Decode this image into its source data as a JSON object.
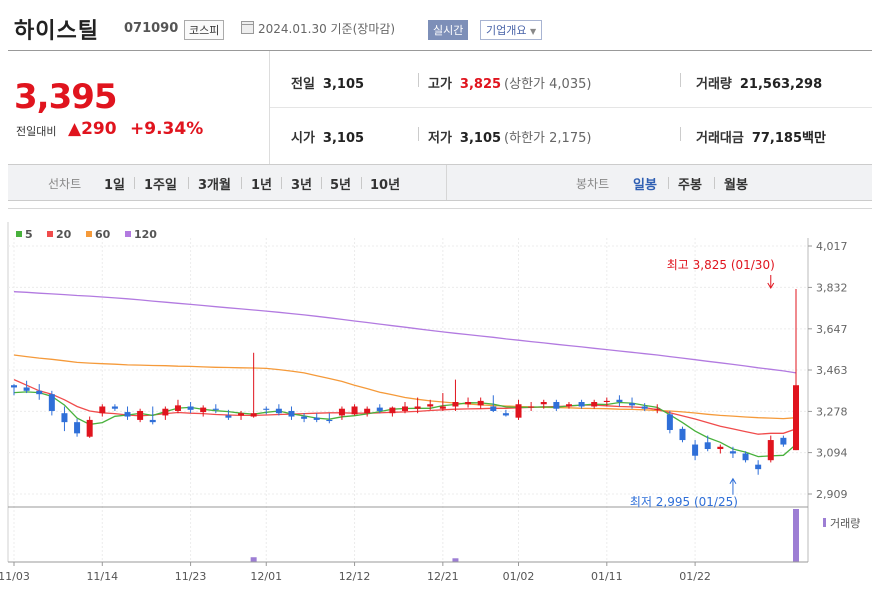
{
  "header": {
    "name": "하이스틸",
    "code": "071090",
    "market": "코스피",
    "date": "2024.01.30 기준(장마감)",
    "realtime_label": "실시간",
    "company_info_label": "기업개요"
  },
  "price": {
    "current": "3,395",
    "change_label": "전일대비",
    "change_value": "290",
    "change_pct": "+9.34%"
  },
  "summary": {
    "prev_close": {
      "label": "전일",
      "value": "3,105"
    },
    "high": {
      "label": "고가",
      "value": "3,825",
      "limit_label": "(상한가",
      "limit_value": "4,035)"
    },
    "volume": {
      "label": "거래량",
      "value": "21,563,298"
    },
    "open": {
      "label": "시가",
      "value": "3,105"
    },
    "low": {
      "label": "저가",
      "value": "3,105",
      "limit_label": "(하한가",
      "limit_value": "2,175)"
    },
    "amount": {
      "label": "거래대금",
      "value": "77,185",
      "unit": "백만"
    }
  },
  "toolbar": {
    "line_label": "선차트",
    "line_items": [
      "1일",
      "1주일",
      "3개월",
      "1년",
      "3년",
      "5년",
      "10년"
    ],
    "candle_label": "봉차트",
    "candle_items": [
      "일봉",
      "주봉",
      "월봉"
    ],
    "candle_selected": "일봉"
  },
  "colors": {
    "up": "#e0141e",
    "down": "#2f6fd8",
    "ma5": "#48b13c",
    "ma20": "#f04c4c",
    "ma60": "#f59a3a",
    "ma120": "#b27ae0",
    "volume": "#9d7ed4"
  },
  "chart_data": {
    "type": "candlestick",
    "y_ticks": [
      "4,017",
      "3,832",
      "3,647",
      "3,463",
      "3,278",
      "3,094",
      "2,909"
    ],
    "ylim": [
      2909,
      4017
    ],
    "x_ticks": [
      {
        "label": "11/03",
        "index": 0
      },
      {
        "label": "11/14",
        "index": 7
      },
      {
        "label": "11/23",
        "index": 14
      },
      {
        "label": "12/01",
        "index": 20
      },
      {
        "label": "12/12",
        "index": 27
      },
      {
        "label": "12/21",
        "index": 34
      },
      {
        "label": "01/02",
        "index": 40
      },
      {
        "label": "01/11",
        "index": 47
      },
      {
        "label": "01/22",
        "index": 54
      }
    ],
    "legend": [
      {
        "name": "5",
        "color": "#48b13c"
      },
      {
        "name": "20",
        "color": "#f04c4c"
      },
      {
        "name": "60",
        "color": "#f59a3a"
      },
      {
        "name": "120",
        "color": "#b27ae0"
      }
    ],
    "annotations": {
      "high": {
        "text": "최고 3,825 (01/30)",
        "index": 60,
        "value": 3825
      },
      "low": {
        "text": "최저 2,995 (01/25)",
        "index": 57,
        "value": 2995
      }
    },
    "volume_label": "거래량",
    "candles": [
      [
        3395,
        3400,
        3350,
        3385
      ],
      [
        3385,
        3415,
        3360,
        3370
      ],
      [
        3370,
        3400,
        3330,
        3355
      ],
      [
        3355,
        3370,
        3260,
        3280
      ],
      [
        3270,
        3300,
        3190,
        3230
      ],
      [
        3230,
        3245,
        3165,
        3180
      ],
      [
        3165,
        3255,
        3160,
        3240
      ],
      [
        3270,
        3310,
        3255,
        3300
      ],
      [
        3300,
        3310,
        3280,
        3290
      ],
      [
        3275,
        3300,
        3240,
        3255
      ],
      [
        3240,
        3290,
        3230,
        3280
      ],
      [
        3240,
        3300,
        3220,
        3230
      ],
      [
        3260,
        3300,
        3240,
        3290
      ],
      [
        3280,
        3330,
        3270,
        3305
      ],
      [
        3300,
        3320,
        3270,
        3285
      ],
      [
        3275,
        3305,
        3255,
        3295
      ],
      [
        3290,
        3310,
        3270,
        3285
      ],
      [
        3260,
        3285,
        3240,
        3250
      ],
      [
        3260,
        3280,
        3240,
        3270
      ],
      [
        3255,
        3540,
        3250,
        3270
      ],
      [
        3290,
        3300,
        3265,
        3285
      ],
      [
        3290,
        3310,
        3260,
        3270
      ],
      [
        3280,
        3300,
        3240,
        3255
      ],
      [
        3255,
        3270,
        3230,
        3245
      ],
      [
        3250,
        3270,
        3230,
        3240
      ],
      [
        3240,
        3270,
        3225,
        3235
      ],
      [
        3260,
        3300,
        3240,
        3290
      ],
      [
        3265,
        3310,
        3260,
        3300
      ],
      [
        3270,
        3300,
        3255,
        3290
      ],
      [
        3295,
        3310,
        3270,
        3280
      ],
      [
        3270,
        3300,
        3255,
        3295
      ],
      [
        3280,
        3320,
        3270,
        3300
      ],
      [
        3290,
        3340,
        3270,
        3300
      ],
      [
        3300,
        3330,
        3285,
        3310
      ],
      [
        3290,
        3360,
        3280,
        3300
      ],
      [
        3300,
        3420,
        3280,
        3320
      ],
      [
        3310,
        3340,
        3295,
        3320
      ],
      [
        3305,
        3340,
        3290,
        3325
      ],
      [
        3300,
        3350,
        3275,
        3280
      ],
      [
        3270,
        3285,
        3255,
        3260
      ],
      [
        3250,
        3330,
        3240,
        3310
      ],
      [
        3300,
        3320,
        3280,
        3300
      ],
      [
        3310,
        3330,
        3290,
        3320
      ],
      [
        3320,
        3330,
        3280,
        3290
      ],
      [
        3300,
        3320,
        3290,
        3310
      ],
      [
        3320,
        3330,
        3290,
        3300
      ],
      [
        3300,
        3330,
        3290,
        3320
      ],
      [
        3320,
        3340,
        3300,
        3325
      ],
      [
        3330,
        3350,
        3300,
        3320
      ],
      [
        3315,
        3340,
        3290,
        3305
      ],
      [
        3300,
        3315,
        3280,
        3290
      ],
      [
        3290,
        3310,
        3270,
        3290
      ],
      [
        3265,
        3280,
        3180,
        3195
      ],
      [
        3200,
        3210,
        3140,
        3150
      ],
      [
        3130,
        3150,
        3060,
        3080
      ],
      [
        3140,
        3170,
        3100,
        3110
      ],
      [
        3110,
        3130,
        3090,
        3120
      ],
      [
        3100,
        3120,
        3070,
        3090
      ],
      [
        3090,
        3100,
        3050,
        3060
      ],
      [
        3040,
        3060,
        2995,
        3020
      ],
      [
        3060,
        3170,
        3050,
        3150
      ],
      [
        3160,
        3170,
        3120,
        3130
      ],
      [
        3105,
        3825,
        3105,
        3395
      ]
    ],
    "ma5": [
      3362,
      3365,
      3362,
      3345,
      3306,
      3248,
      3220,
      3228,
      3256,
      3262,
      3269,
      3260,
      3277,
      3293,
      3296,
      3287,
      3281,
      3277,
      3270,
      3266,
      3274,
      3280,
      3267,
      3258,
      3248,
      3243,
      3254,
      3259,
      3267,
      3277,
      3288,
      3291,
      3292,
      3292,
      3304,
      3309,
      3317,
      3316,
      3310,
      3298,
      3296,
      3297,
      3298,
      3296,
      3303,
      3306,
      3310,
      3309,
      3318,
      3315,
      3305,
      3296,
      3263,
      3228,
      3190,
      3161,
      3140,
      3110,
      3096,
      3076,
      3079,
      3082,
      3130
    ],
    "ma20": [
      3420,
      3395,
      3370,
      3355,
      3330,
      3300,
      3280,
      3272,
      3268,
      3262,
      3258,
      3262,
      3268,
      3273,
      3270,
      3268,
      3264,
      3262,
      3260,
      3260,
      3262,
      3264,
      3266,
      3268,
      3270,
      3272,
      3272,
      3270,
      3270,
      3272,
      3274,
      3276,
      3278,
      3282,
      3285,
      3288,
      3289,
      3290,
      3292,
      3292,
      3294,
      3296,
      3298,
      3300,
      3302,
      3306,
      3306,
      3303,
      3300,
      3298,
      3295,
      3286,
      3272,
      3258,
      3244,
      3228,
      3212,
      3200,
      3188,
      3176,
      3180,
      3180,
      3200
    ],
    "ma60": [
      3530,
      3523,
      3516,
      3511,
      3504,
      3497,
      3494,
      3491,
      3489,
      3486,
      3485,
      3483,
      3482,
      3480,
      3479,
      3477,
      3475,
      3474,
      3473,
      3472,
      3470,
      3465,
      3458,
      3450,
      3437,
      3425,
      3412,
      3395,
      3380,
      3364,
      3352,
      3340,
      3332,
      3325,
      3320,
      3315,
      3311,
      3307,
      3304,
      3302,
      3300,
      3298,
      3296,
      3295,
      3294,
      3292,
      3291,
      3290,
      3288,
      3287,
      3285,
      3282,
      3280,
      3276,
      3271,
      3265,
      3260,
      3257,
      3253,
      3250,
      3248,
      3246,
      3250
    ],
    "ma120": [
      3813,
      3810,
      3806,
      3803,
      3800,
      3796,
      3793,
      3789,
      3785,
      3781,
      3776,
      3771,
      3766,
      3761,
      3756,
      3751,
      3746,
      3741,
      3736,
      3731,
      3726,
      3721,
      3715,
      3709,
      3703,
      3696,
      3689,
      3682,
      3675,
      3668,
      3661,
      3654,
      3647,
      3640,
      3633,
      3627,
      3621,
      3615,
      3609,
      3602,
      3596,
      3590,
      3584,
      3578,
      3572,
      3566,
      3560,
      3554,
      3548,
      3542,
      3536,
      3530,
      3523,
      3516,
      3509,
      3502,
      3495,
      3488,
      3481,
      3473,
      3466,
      3459,
      3450
    ],
    "volumes": [
      0.02,
      0.02,
      0.02,
      0.02,
      0.02,
      0.02,
      0.02,
      0.02,
      0.02,
      0.02,
      0.02,
      0.02,
      0.02,
      0.02,
      0.02,
      0.02,
      0.02,
      0.02,
      0.02,
      0.09,
      0.02,
      0.02,
      0.02,
      0.02,
      0.02,
      0.02,
      0.02,
      0.02,
      0.02,
      0.02,
      0.02,
      0.02,
      0.02,
      0.02,
      0.02,
      0.07,
      0.02,
      0.02,
      0.02,
      0.02,
      0.02,
      0.02,
      0.02,
      0.02,
      0.02,
      0.02,
      0.02,
      0.02,
      0.02,
      0.02,
      0.02,
      0.02,
      0.02,
      0.02,
      0.02,
      0.02,
      0.02,
      0.02,
      0.02,
      0.02,
      0.02,
      0.02,
      1.0
    ]
  }
}
